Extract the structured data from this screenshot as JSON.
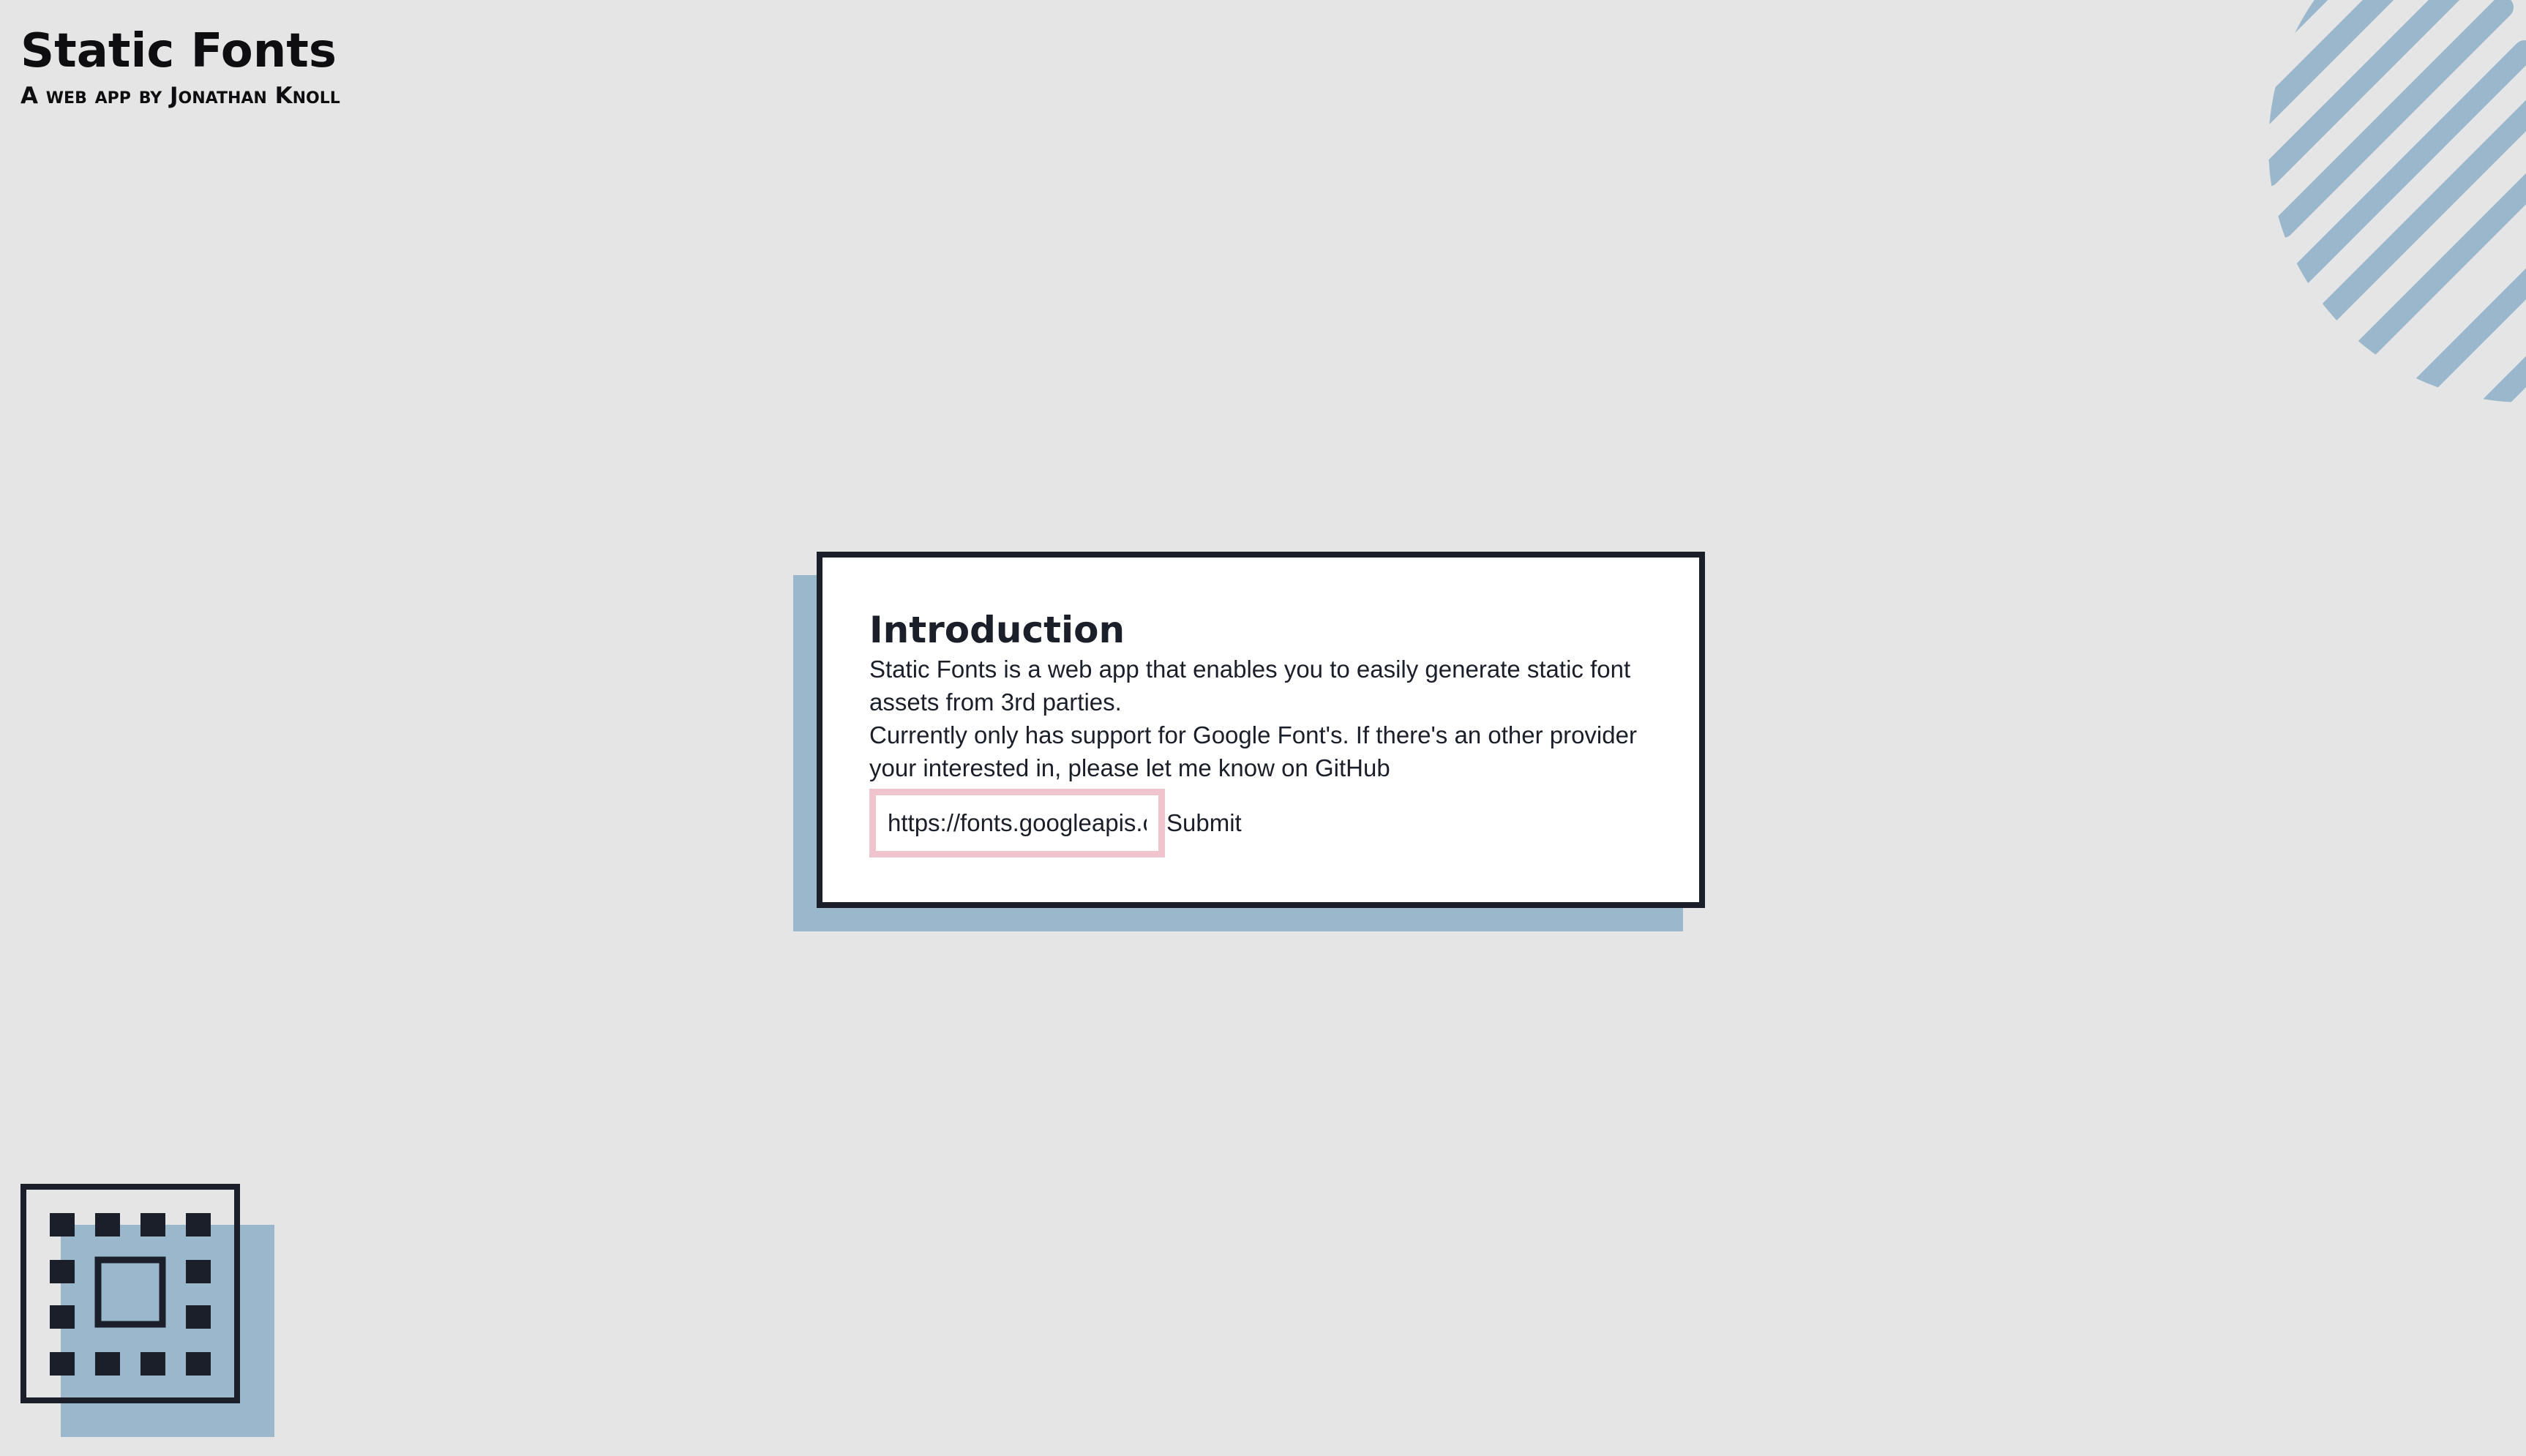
{
  "header": {
    "title": "Static Fonts",
    "subtitle": "A web app by Jonathan Knoll"
  },
  "intro": {
    "heading": "Introduction",
    "paragraph_1": "Static Fonts is a web app that enables you to easily generate static font assets from 3rd parties.",
    "paragraph_2": "Currently only has support for Google Font's. If there's an other provider your interested in, please let me know on GitHub"
  },
  "form": {
    "url_value": "https://fonts.googleapis.com/",
    "submit_label": "Submit"
  },
  "colors": {
    "background": "#e5e5e5",
    "ink": "#1b1f2a",
    "accent_blue": "#9ab7cb",
    "input_border_pink": "#f0c4cd"
  },
  "icons": {
    "decoration_top_right": "striped-circle",
    "logo_bottom_left": "chip-logo"
  }
}
